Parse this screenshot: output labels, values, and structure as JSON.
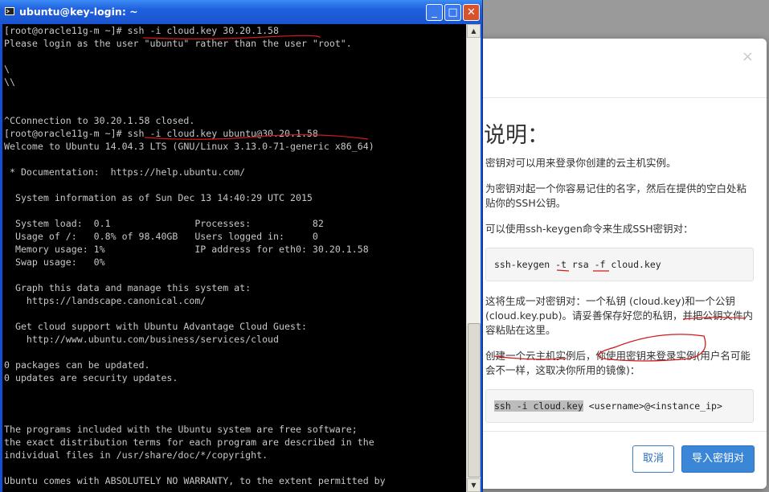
{
  "window": {
    "title": "ubuntu@key-login: ~",
    "minimize_glyph": "_",
    "maximize_glyph": "□",
    "close_glyph": "✕"
  },
  "terminal": {
    "lines": [
      "[root@oracle11g-m ~]# ssh -i cloud.key 30.20.1.58",
      "Please login as the user \"ubuntu\" rather than the user \"root\".",
      "",
      "\\",
      "\\\\",
      "",
      "",
      "^CConnection to 30.20.1.58 closed.",
      "[root@oracle11g-m ~]# ssh -i cloud.key ubuntu@30.20.1.58",
      "Welcome to Ubuntu 14.04.3 LTS (GNU/Linux 3.13.0-71-generic x86_64)",
      "",
      " * Documentation:  https://help.ubuntu.com/",
      "",
      "  System information as of Sun Dec 13 14:40:29 UTC 2015",
      "",
      "  System load:  0.1               Processes:           82",
      "  Usage of /:   0.8% of 98.40GB   Users logged in:     0",
      "  Memory usage: 1%                IP address for eth0: 30.20.1.58",
      "  Swap usage:   0%",
      "",
      "  Graph this data and manage this system at:",
      "    https://landscape.canonical.com/",
      "",
      "  Get cloud support with Ubuntu Advantage Cloud Guest:",
      "    http://www.ubuntu.com/business/services/cloud",
      "",
      "0 packages can be updated.",
      "0 updates are security updates.",
      "",
      "",
      "",
      "The programs included with the Ubuntu system are free software;",
      "the exact distribution terms for each program are described in the",
      "individual files in /usr/share/doc/*/copyright.",
      "",
      "Ubuntu comes with ABSOLUTELY NO WARRANTY, to the extent permitted by"
    ]
  },
  "modal": {
    "close_glyph": "×",
    "title": "说明：",
    "para1": "密钥对可以用来登录你创建的云主机实例。",
    "para2": "为密钥对起一个你容易记住的名字，然后在提供的空白处粘贴你的SSH公钥。",
    "para3": "可以使用ssh-keygen命令来生成SSH密钥对：",
    "code1": "ssh-keygen -t rsa -f cloud.key",
    "para4": "这将生成一对密钥对：一个私钥 (cloud.key)和一个公钥 (cloud.key.pub)。请妥善保存好您的私钥，并把公钥文件内容粘贴在这里。",
    "para5": "创建一个云主机实例后，你使用密钥来登录实例(用户名可能会不一样，这取决你所用的镜像)：",
    "code2_selected": "ssh -i cloud.key",
    "code2_rest": " <username>@<instance_ip>",
    "cancel_label": "取消",
    "import_label": "导入密钥对"
  },
  "colors": {
    "annotation_red": "#d11a1a",
    "primary_button": "#3b86d6",
    "title_bar": "#1f5fdc"
  }
}
